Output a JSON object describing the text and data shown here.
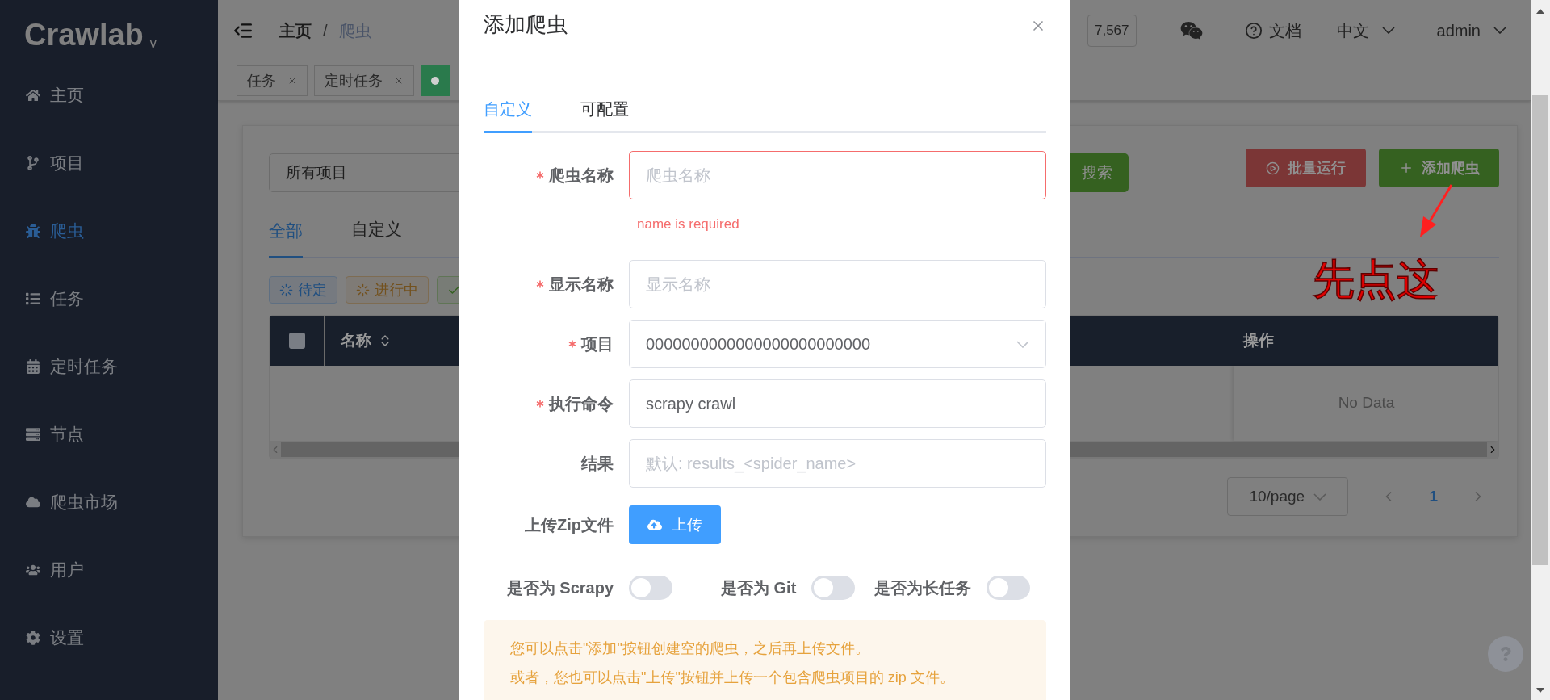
{
  "sidebar": {
    "logo": "Crawlab",
    "version": "v",
    "items": [
      {
        "label": "主页",
        "selected": false
      },
      {
        "label": "项目",
        "selected": false
      },
      {
        "label": "爬虫",
        "selected": true
      },
      {
        "label": "任务",
        "selected": false
      },
      {
        "label": "定时任务",
        "selected": false
      },
      {
        "label": "节点",
        "selected": false
      },
      {
        "label": "爬虫市场",
        "selected": false
      },
      {
        "label": "用户",
        "selected": false
      },
      {
        "label": "设置",
        "selected": false
      }
    ]
  },
  "header": {
    "breadcrumb": [
      "主页",
      "爬虫"
    ],
    "breadcrumb_separator": "/",
    "github_stars": "7,567",
    "docs": "文档",
    "language": "中文",
    "user": "admin"
  },
  "tags_view": [
    {
      "label": "任务",
      "active": false
    },
    {
      "label": "定时任务",
      "active": false
    },
    {
      "active": true
    }
  ],
  "page": {
    "project_select": "所有项目",
    "search_button": "搜索",
    "run_button": "批量运行",
    "add_button": "添加爬虫",
    "tabs": [
      {
        "label": "全部",
        "selected": true
      },
      {
        "label": "自定义",
        "selected": false
      }
    ],
    "status_filters": [
      {
        "label": "待定",
        "kind": "pending"
      },
      {
        "label": "进行中",
        "kind": "running"
      },
      {
        "kind": "finished"
      }
    ],
    "table": {
      "select_all_checked": false,
      "columns": [
        "名称",
        "操作"
      ],
      "empty_text": "No Data"
    },
    "pagination": {
      "page_size": "10/page",
      "current_page": "1"
    }
  },
  "annotation": {
    "text": "先点这"
  },
  "dialog": {
    "title": "添加爬虫",
    "tabs": [
      {
        "label": "自定义",
        "selected": true
      },
      {
        "label": "可配置",
        "selected": false
      }
    ],
    "fields": [
      {
        "label": "爬虫名称",
        "required": true,
        "kind": "input",
        "placeholder": "爬虫名称",
        "error": "name is required"
      },
      {
        "label": "显示名称",
        "required": true,
        "kind": "input",
        "placeholder": "显示名称"
      },
      {
        "label": "项目",
        "required": true,
        "kind": "select",
        "value": "0000000000000000000000000"
      },
      {
        "label": "执行命令",
        "required": true,
        "kind": "input",
        "value": "scrapy crawl"
      },
      {
        "label": "结果",
        "required": false,
        "kind": "input",
        "placeholder": "默认: results_<spider_name>"
      },
      {
        "label": "上传Zip文件",
        "required": false,
        "kind": "upload",
        "button": "上传"
      }
    ],
    "switches": [
      {
        "label": "是否为 Scrapy",
        "on": false
      },
      {
        "label": "是否为 Git",
        "on": false
      },
      {
        "label": "是否为长任务",
        "on": false
      }
    ],
    "notice": [
      "您可以点击\"添加\"按钮创建空的爬虫，之后再上传文件。",
      "或者，您也可以点击\"上传\"按钮并上传一个包含爬虫项目的 zip 文件。"
    ]
  }
}
